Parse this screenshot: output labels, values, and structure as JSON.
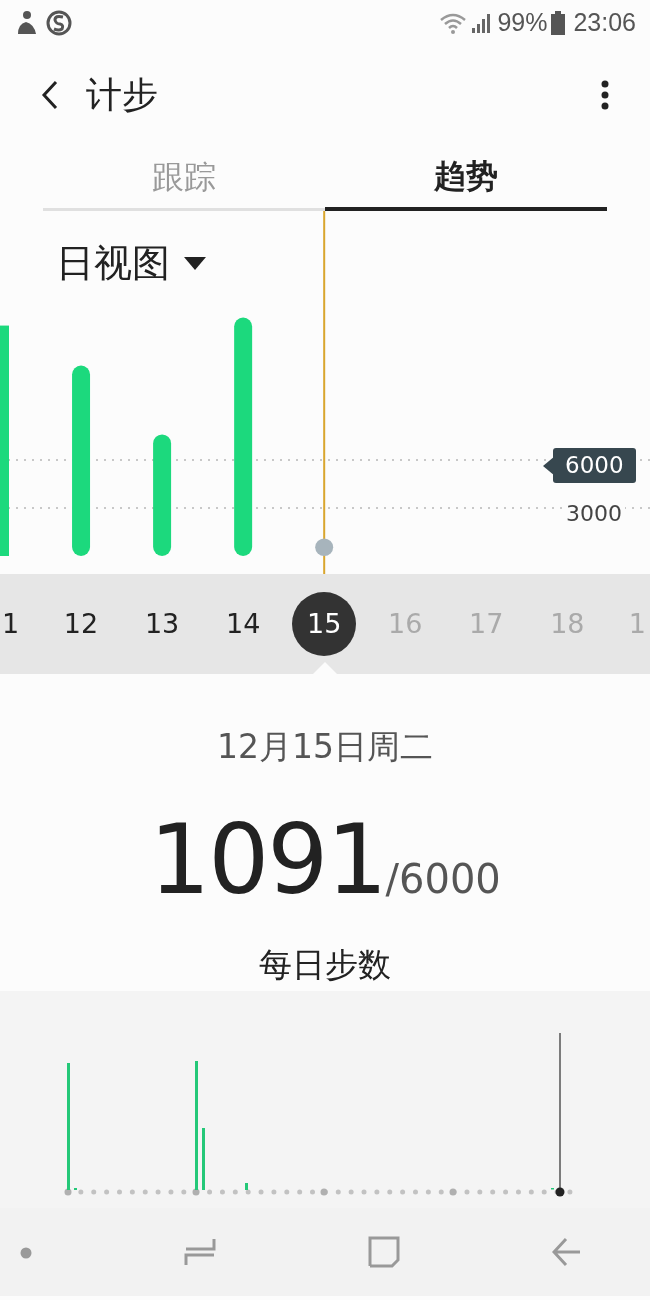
{
  "status_bar": {
    "battery": "99%",
    "time": "23:06"
  },
  "header": {
    "title": "计步"
  },
  "tabs": [
    {
      "label": "跟踪",
      "selected": false
    },
    {
      "label": "趋势",
      "selected": true
    }
  ],
  "view_selector": {
    "label": "日视图"
  },
  "chart": {
    "chart_data": {
      "type": "bar",
      "x": [
        11,
        12,
        13,
        14,
        15
      ],
      "xlim": [
        11,
        19.02
      ],
      "xticks": [
        12,
        13,
        14,
        15,
        16,
        17,
        18
      ],
      "ref_lines": [
        {
          "axis": "x",
          "value": 15,
          "color": "#d9a62e"
        }
      ],
      "values": [
        14400,
        11900,
        7600,
        14900,
        1091
      ],
      "ylim": [
        0,
        21560
      ],
      "yticks": [
        {
          "value": 3000,
          "label": "3000"
        },
        {
          "value": 6000,
          "label": "6000"
        }
      ]
    }
  },
  "cut_date_labels": [
    "1",
    "1"
  ],
  "dates": [
    {
      "selected": false,
      "future": false
    },
    {
      "selected": false,
      "future": false
    },
    {
      "selected": false,
      "future": false
    },
    {
      "selected": false,
      "future": false
    },
    {
      "selected": true,
      "future": false
    },
    {
      "selected": false,
      "future": true
    },
    {
      "selected": false,
      "future": true
    },
    {
      "selected": false,
      "future": true
    },
    {
      "selected": false,
      "future": true
    }
  ],
  "summary": {
    "date": "12月15日周二",
    "steps": "1091",
    "goal": "/6000",
    "caption": "每日步数"
  }
}
